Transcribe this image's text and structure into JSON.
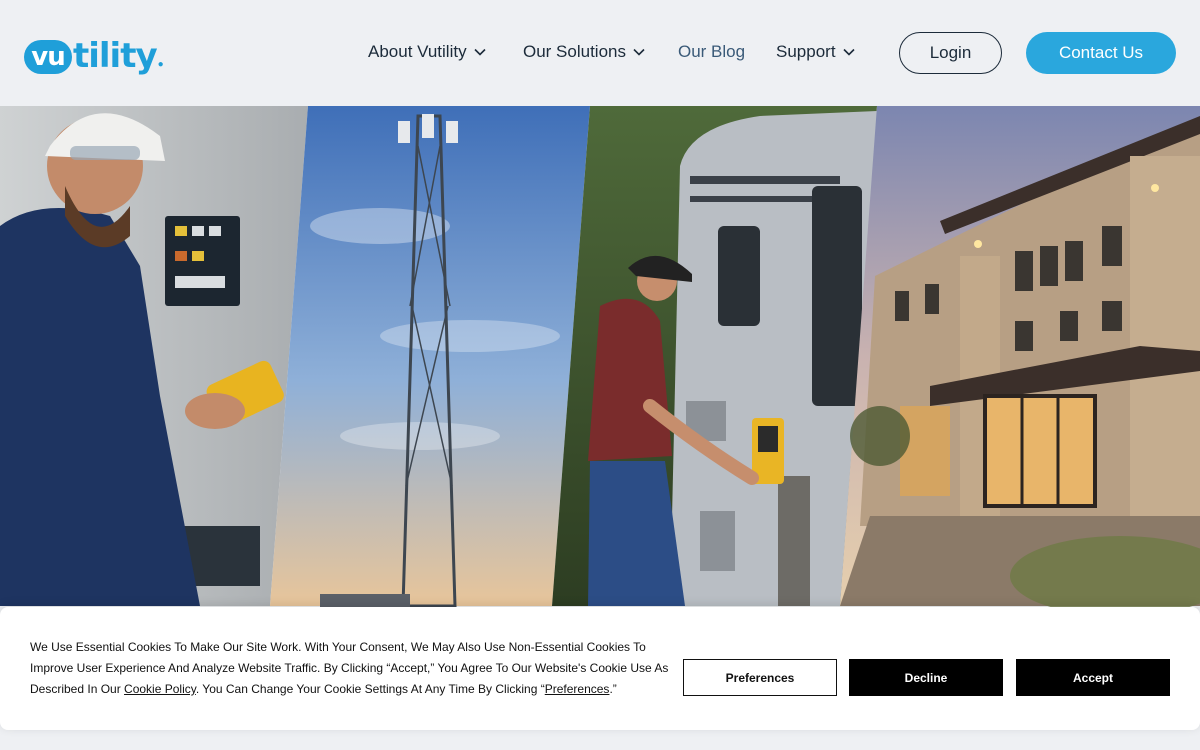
{
  "brand": {
    "logo_part1": "vu",
    "logo_part2": "tility",
    "color": "#1f9fd9"
  },
  "nav": {
    "items": [
      {
        "label": "About Vutility",
        "icon": "chevron-down-icon"
      },
      {
        "label": "Our Solutions",
        "icon": "chevron-down-icon"
      },
      {
        "label": "Our Blog"
      },
      {
        "label": "Support",
        "icon": "chevron-down-icon"
      }
    ],
    "login_label": "Login",
    "contact_label": "Contact Us"
  },
  "hero": {
    "panels": [
      "technician-panel-photo",
      "cell-tower-photo",
      "rv-hookup-photo",
      "hotel-building-photo"
    ]
  },
  "cookie": {
    "text_part1": "We Use Essential Cookies To Make Our Site Work. With Your Consent, We May Also Use Non-Essential Cookies To Improve User Experience And Analyze Website Traffic. By Clicking “Accept,” You Agree To Our Website's Cookie Use As Described In Our ",
    "policy_link": "Cookie Policy",
    "text_part2": ". You Can Change Your Cookie Settings At Any Time By Clicking “",
    "preferences_link": "Preferences",
    "text_part3": ".”",
    "preferences_button": "Preferences",
    "decline_button": "Decline",
    "accept_button": "Accept"
  },
  "colors": {
    "accent": "#2aa7dd",
    "header_bg": "#eef0f3",
    "text_dark": "#1c2b3a"
  }
}
